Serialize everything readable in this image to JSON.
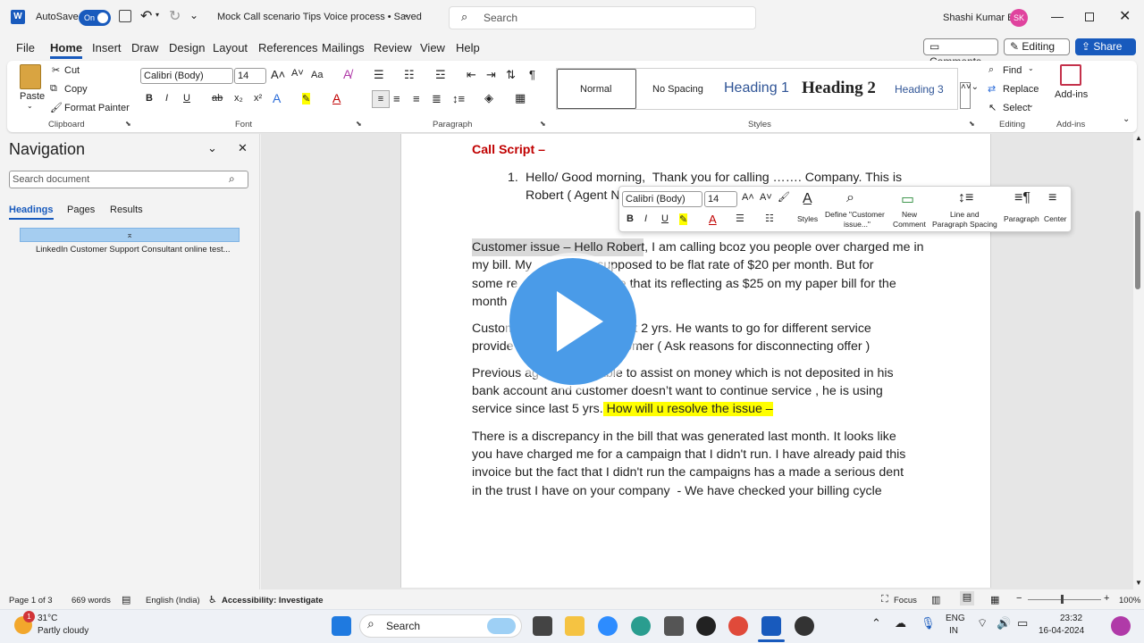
{
  "titlebar": {
    "logo": "W",
    "autosave_label": "AutoSave",
    "autosave_state": "On",
    "doc_title": "Mock Call scenario Tips Voice process • Saved",
    "search_placeholder": "Search",
    "user_name": "Shashi Kumar E",
    "user_initials": "SK"
  },
  "menu": [
    "File",
    "Home",
    "Insert",
    "Draw",
    "Design",
    "Layout",
    "References",
    "Mailings",
    "Review",
    "View",
    "Help"
  ],
  "menu_active": "Home",
  "top_buttons": {
    "comments": "Comments",
    "editing": "Editing",
    "share": "Share"
  },
  "ribbon": {
    "clipboard": {
      "paste": "Paste",
      "cut": "Cut",
      "copy": "Copy",
      "format_painter": "Format Painter",
      "label": "Clipboard"
    },
    "font": {
      "name": "Calibri (Body)",
      "size": "14",
      "label": "Font",
      "grow": "A^",
      "shrink": "A˅",
      "case": "Aa"
    },
    "paragraph": {
      "label": "Paragraph"
    },
    "styles": {
      "items": [
        "Normal",
        "No Spacing",
        "Heading 1",
        "Heading 2",
        "Heading 3"
      ],
      "label": "Styles"
    },
    "editing": {
      "find": "Find",
      "replace": "Replace",
      "select": "Select",
      "label": "Editing"
    },
    "addins": {
      "button": "Add-ins",
      "label": "Add-ins"
    }
  },
  "navigation": {
    "title": "Navigation",
    "search_placeholder": "Search document",
    "tabs": [
      "Headings",
      "Pages",
      "Results"
    ],
    "active_tab": "Headings",
    "items": [
      "LinkedIn Customer Support Consultant online test..."
    ]
  },
  "document": {
    "heading": "Call Script –",
    "list_number": "1.",
    "list_line1": "Hello/ Good morning,  Thank you for calling ……. Company. This is",
    "list_line2": "Robert ( Agent N",
    "para1": [
      "Customer issue – Hello Robert, I am calling bcoz you people over charged me in",
      "my bill. My               is supposed to be flat rate of $20 per month. But for",
      "some re                         see that its reflecting as $25 on my paper bill for the",
      "month"
    ],
    "para2": [
      "Custom                          e last 2 yrs. He wants to go for different service",
      "provide                         customer ( Ask reasons for disconnecting offer )"
    ],
    "para3_line1": "Previous ag                 able to assist on money which is not deposited in his",
    "para3_line2": "bank account and customer doesn’t want to continue service , he is using",
    "para3_line3_plain": "service since last 5 yrs.",
    "para3_line3_highlight": " How will u resolve the issue –",
    "para4": [
      "There is a discrepancy in the bill that was generated last month. It looks like",
      "you have charged me for a campaign that I didn't run. I have already paid this",
      "invoice but the fact that I didn't run the campaigns has a made a serious dent",
      "in the trust I have on your company  - We have checked your billing cycle"
    ]
  },
  "minibar": {
    "font": "Calibri (Body)",
    "size": "14",
    "styles": "Styles",
    "define1": "Define \"Customer",
    "define2": "issue...\"",
    "new1": "New",
    "new2": "Comment",
    "spacing1": "Line and",
    "spacing2": "Paragraph Spacing",
    "paragraph": "Paragraph",
    "center": "Center"
  },
  "status": {
    "page": "Page 1 of 3",
    "words": "669 words",
    "language": "English (India)",
    "accessibility": "Accessibility: Investigate",
    "focus": "Focus",
    "zoom": "100%"
  },
  "taskbar": {
    "weather_temp": "31°C",
    "weather_desc": "Partly cloudy",
    "search": "Search",
    "lang1": "ENG",
    "lang2": "IN",
    "time": "23:32",
    "date": "16-04-2024",
    "badge": "1"
  },
  "colors": {
    "accent": "#185abd",
    "heading_red": "#c00000",
    "highlight": "#ffff00"
  }
}
